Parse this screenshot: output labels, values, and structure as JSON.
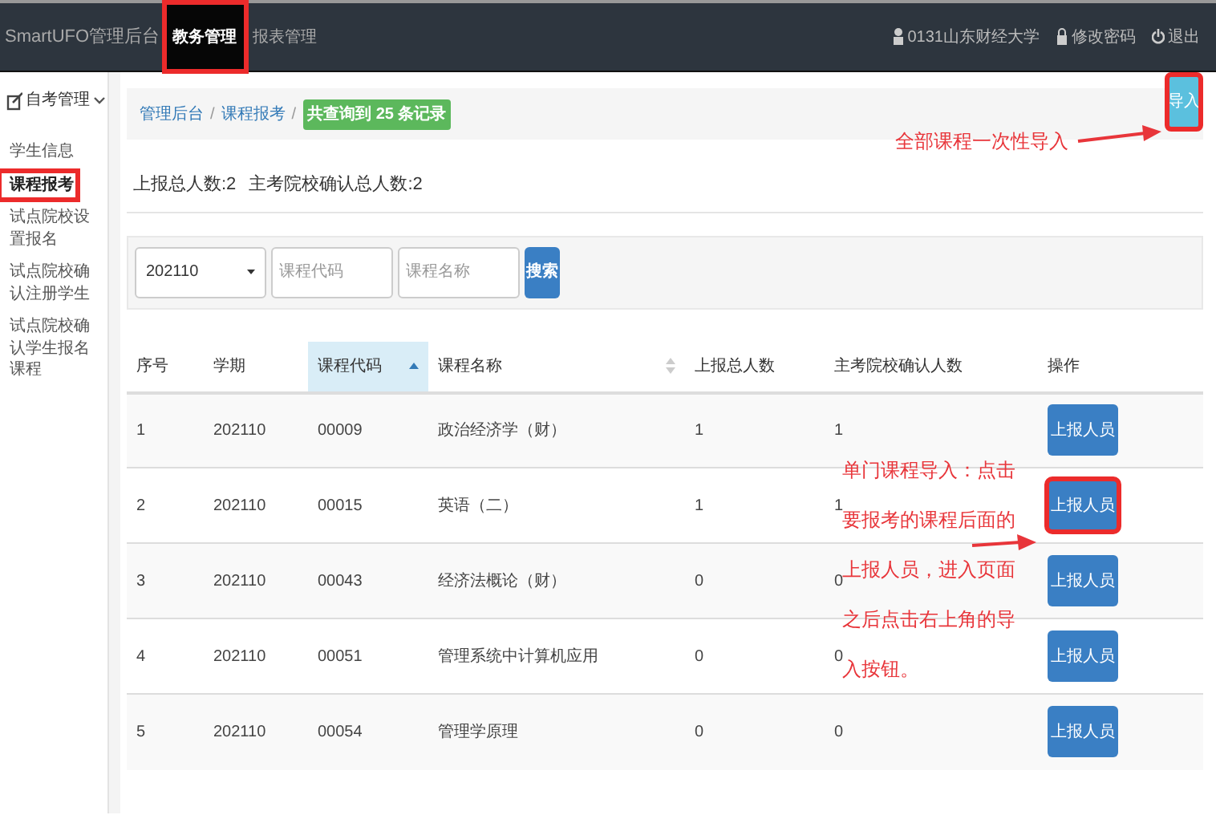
{
  "navbar": {
    "brand": "SmartUFO管理后台",
    "menu": [
      {
        "label": "教务管理",
        "selected": true,
        "annotated": true
      },
      {
        "label": "报表管理",
        "selected": false,
        "annotated": false
      }
    ],
    "links": [
      {
        "kind": "user",
        "label": "0131山东财经大学"
      },
      {
        "kind": "password",
        "label": "修改密码"
      },
      {
        "kind": "logout",
        "label": "退出"
      }
    ]
  },
  "sidebar": {
    "group": "自考管理",
    "expanded": true,
    "items": [
      {
        "label": "学生信息",
        "selected": false,
        "annotated": false
      },
      {
        "label": "课程报考",
        "selected": true,
        "annotated": true
      },
      {
        "label": "试点院校设置报名",
        "selected": false,
        "annotated": false
      },
      {
        "label": "试点院校确认注册学生",
        "selected": false,
        "annotated": false
      },
      {
        "label": "试点院校确认学生报名课程",
        "selected": false,
        "annotated": false
      }
    ]
  },
  "breadcrumb": [
    {
      "label": "管理后台",
      "separator": "/"
    },
    {
      "label": "课程报考",
      "separator": "/"
    }
  ],
  "record_badge": "共查询到 25 条记录",
  "import_button": {
    "label": "导入",
    "annotated": true
  },
  "summary": [
    "上报总人数:2",
    "主考院校确认总人数:2"
  ],
  "filter": {
    "term": "202110",
    "code_placeholder": "课程代码",
    "name_placeholder": "课程名称",
    "search_button": "搜索"
  },
  "table": {
    "columns": [
      {
        "label": "序号",
        "sortable": false,
        "sorted": false
      },
      {
        "label": "学期",
        "sortable": false,
        "sorted": false
      },
      {
        "label": "课程代码",
        "sortable": true,
        "sorted": true
      },
      {
        "label": "课程名称",
        "sortable": true,
        "sorted": false
      },
      {
        "label": "上报总人数",
        "sortable": false,
        "sorted": false
      },
      {
        "label": "主考院校确认人数",
        "sortable": false,
        "sorted": false
      },
      {
        "label": "操作",
        "sortable": false,
        "sorted": false
      }
    ],
    "rows": [
      {
        "cells": [
          "1",
          "202110",
          "00009",
          "政治经济学（财）",
          "1",
          "1"
        ],
        "action": "上报人员",
        "annotated": false
      },
      {
        "cells": [
          "2",
          "202110",
          "00015",
          "英语（二）",
          "1",
          "1"
        ],
        "action": "上报人员",
        "annotated": true
      },
      {
        "cells": [
          "3",
          "202110",
          "00043",
          "经济法概论（财）",
          "0",
          "0"
        ],
        "action": "上报人员",
        "annotated": false
      },
      {
        "cells": [
          "4",
          "202110",
          "00051",
          "管理系统中计算机应用",
          "0",
          "0"
        ],
        "action": "上报人员",
        "annotated": false
      },
      {
        "cells": [
          "5",
          "202110",
          "00054",
          "管理学原理",
          "0",
          "0"
        ],
        "action": "上报人员",
        "annotated": false
      }
    ]
  },
  "annotations": [
    {
      "kind": "import_all",
      "lines": [
        "全部课程一次性导入"
      ]
    },
    {
      "kind": "import_single",
      "lines": [
        "单门课程导入：点击",
        "要报考的课程后面的",
        "上报人员，进入页面",
        "之后点击右上角的导",
        "入按钮。"
      ]
    }
  ]
}
